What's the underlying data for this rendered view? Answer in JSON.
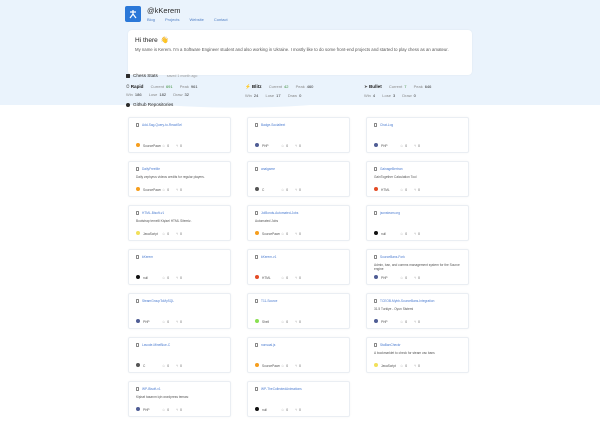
{
  "header": {
    "brand": "@kKerem",
    "nav": [
      "Blog",
      "Projects",
      "Website",
      "Contact"
    ]
  },
  "intro": {
    "greeting": "Hi there",
    "wave_emoji": "👋",
    "text": "My name is Kerem. I'm a Software Engineer student and also working in Ukraine. I mostly like to do some front-end projects and started to play chess as an amateur."
  },
  "chess": {
    "title": "Chess Stats",
    "updated": "saved 1 month ago",
    "modes": [
      {
        "name": "Rapid",
        "current_label": "Current",
        "current": "691",
        "peak_label": "Peak",
        "peak": "961",
        "win_label": "Win",
        "win": "186",
        "lose_label": "Lose",
        "lose": "182",
        "draw_label": "Draw",
        "draw": "32"
      },
      {
        "name": "Blitz",
        "current_label": "Current",
        "current": "42",
        "peak_label": "Peak",
        "peak": "460",
        "win_label": "Win",
        "win": "24",
        "lose_label": "Lose",
        "lose": "17",
        "draw_label": "Draw",
        "draw": "0"
      },
      {
        "name": "Bullet",
        "current_label": "Current",
        "current": "7",
        "peak_label": "Peak",
        "peak": "646",
        "win_label": "Win",
        "win": "4",
        "lose_label": "Lose",
        "lose": "3",
        "draw_label": "Draw",
        "draw": "0"
      }
    ]
  },
  "repos": {
    "title": "Github Repositories",
    "items": [
      {
        "name": "Add-Sag-Query-to-ReactSel",
        "desc": "",
        "lang": "SourcePawn",
        "lang_color": "#f69e1d",
        "stars": "0",
        "forks": "0"
      },
      {
        "name": "Badge-Socialtext",
        "desc": "",
        "lang": "PHP",
        "lang_color": "#4F5D95",
        "stars": "0",
        "forks": "0"
      },
      {
        "name": "Chat-Log",
        "desc": "",
        "lang": "PHP",
        "lang_color": "#4F5D95",
        "stars": "0",
        "forks": "0"
      },
      {
        "name": "DailyFreeMe",
        "desc": "Daily zephyrus videos credits for regular players.",
        "lang": "SourcePawn",
        "lang_color": "#f69e1d",
        "stars": "0",
        "forks": "0"
      },
      {
        "name": "analgame",
        "desc": "",
        "lang": "C",
        "lang_color": "#555555",
        "stars": "0",
        "forks": "0"
      },
      {
        "name": "GainageBertran",
        "desc": "GainTogether Calculation Tool",
        "lang": "HTML",
        "lang_color": "#e34c26",
        "stars": "0",
        "forks": "0"
      },
      {
        "name": "HTML-Bisoft-v1",
        "desc": "Bootstrap temelli Kişisel HTML Sitemiz.",
        "lang": "JavaScript",
        "lang_color": "#f1e05a",
        "stars": "0",
        "forks": "0"
      },
      {
        "name": "JolBonds-Automated-Jobs",
        "desc": "Automated Jobs",
        "lang": "SourcePawn",
        "lang_color": "#f69e1d",
        "stars": "0",
        "forks": "0"
      },
      {
        "name": "jsonsteam.org",
        "desc": "",
        "lang": "null",
        "lang_color": "#111111",
        "stars": "0",
        "forks": "0"
      },
      {
        "name": "kKerem",
        "desc": "",
        "lang": "null",
        "lang_color": "#111111",
        "stars": "0",
        "forks": "0"
      },
      {
        "name": "kKerem-v1",
        "desc": "",
        "lang": "HTML",
        "lang_color": "#e34c26",
        "stars": "0",
        "forks": "0"
      },
      {
        "name": "SourceBans-Fork",
        "desc": "Admin, ban, and comms management system for the Source engine",
        "lang": "PHP",
        "lang_color": "#4F5D95",
        "stars": "0",
        "forks": "0"
      },
      {
        "name": "SteamGroupToMySQL",
        "desc": "",
        "lang": "PHP",
        "lang_color": "#4F5D95",
        "stars": "0",
        "forks": "0"
      },
      {
        "name": "T11-Source",
        "desc": "",
        "lang": "Shell",
        "lang_color": "#89e051",
        "stars": "0",
        "forks": "0"
      },
      {
        "name": "TCEOB-Mybb-SourceBans-Integration",
        "desc": "31.5 Turkiye - Oyun Sistemi",
        "lang": "PHP",
        "lang_color": "#4F5D95",
        "stars": "0",
        "forks": "0"
      },
      {
        "name": "Lavode-MineBlue-C",
        "desc": "",
        "lang": "C",
        "lang_color": "#555555",
        "stars": "0",
        "forks": "0"
      },
      {
        "name": "nonsual.js",
        "desc": "",
        "lang": "SourcePawn",
        "lang_color": "#f69e1d",
        "stars": "0",
        "forks": "0"
      },
      {
        "name": "StaBanCheckr",
        "desc": "A bookmarklet to check for steam vac bans",
        "lang": "JavaScript",
        "lang_color": "#f1e05a",
        "stars": "0",
        "forks": "0"
      },
      {
        "name": "WP-Bisoft-v1",
        "desc": "Kişisel tasarım için wordpress teması",
        "lang": "PHP",
        "lang_color": "#4F5D95",
        "stars": "0",
        "forks": "0"
      },
      {
        "name": "WP-TheCollectedAnimations",
        "desc": "",
        "lang": "null",
        "lang_color": "#111111",
        "stars": "0",
        "forks": "0"
      },
      {
        "name": "",
        "desc": "",
        "lang": "",
        "lang_color": "#ffffff",
        "stars": "",
        "forks": ""
      }
    ]
  },
  "colors": {
    "accent": "#2b78d8",
    "band": "#eaf3fc",
    "link": "#4a7bd0"
  }
}
